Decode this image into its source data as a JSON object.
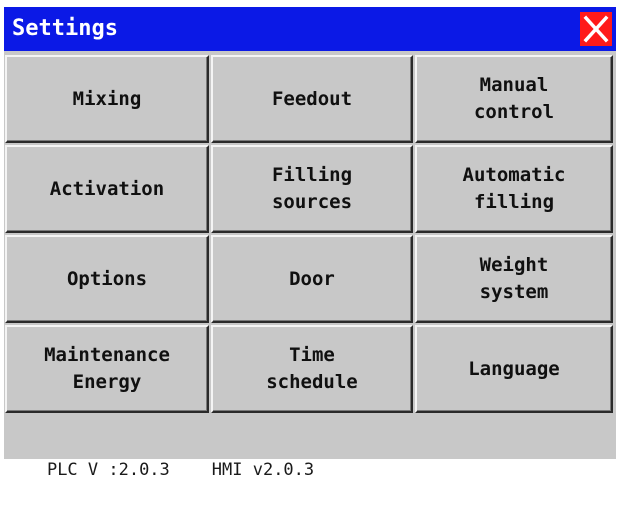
{
  "window": {
    "title": "Settings",
    "close_icon": "close-icon",
    "colors": {
      "titlebar": "#0b19e6",
      "close_button": "#ff1a1a",
      "panel": "#c8c8c8"
    }
  },
  "menu": {
    "mixing": "Mixing",
    "feedout": "Feedout",
    "manual_control": "Manual\ncontrol",
    "activation": "Activation",
    "filling_sources": "Filling\nsources",
    "automatic_filling": "Automatic\nfilling",
    "options": "Options",
    "door": "Door",
    "weight_system": "Weight\nsystem",
    "maintenance_energy": "Maintenance\nEnergy",
    "time_schedule": "Time\nschedule",
    "language": "Language"
  },
  "status": {
    "plc_version": "PLC V :2.0.3",
    "hmi_version": "HMI v2.0.3"
  }
}
